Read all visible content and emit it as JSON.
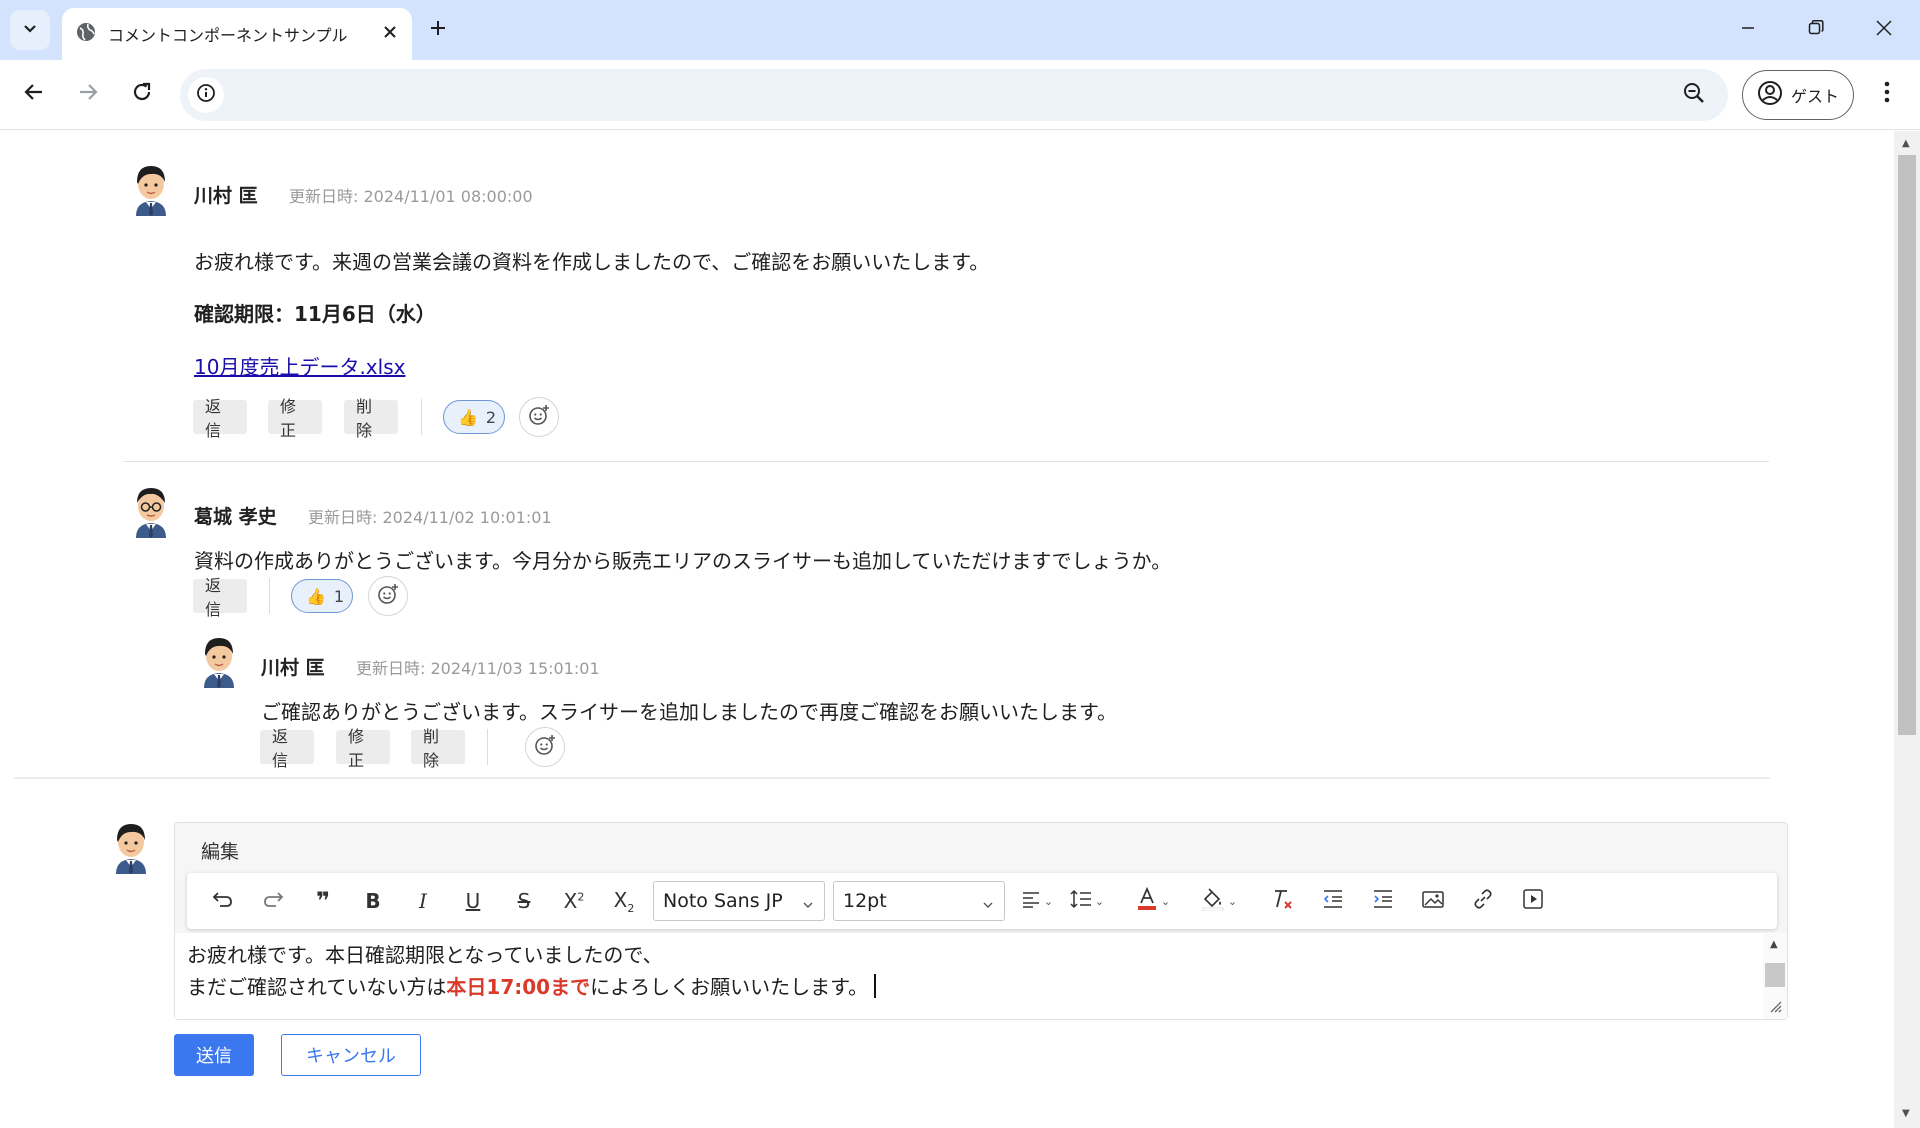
{
  "browser": {
    "tab_title": "コメントコンポーネントサンプル",
    "profile_label": "ゲスト"
  },
  "icons": {
    "tab_menu": "chevron-down-icon",
    "favicon": "globe-icon",
    "close_tab": "close-icon",
    "new_tab": "plus-icon",
    "back": "arrow-left-icon",
    "forward": "arrow-right-icon",
    "reload": "reload-icon",
    "site_info": "info-icon",
    "zoom": "zoom-out-icon",
    "profile": "account-circle-icon",
    "menu": "kebab-menu-icon"
  },
  "colors": {
    "accent": "#3b78f0",
    "highlight_text": "#d93a2a",
    "link": "#1a0dab",
    "reaction_border": "#6e97d6",
    "tabbar_bg": "#d3e3fd"
  },
  "comments": [
    {
      "author": "川村 匡",
      "timestamp": "更新日時: 2024/11/01 08:00:00",
      "body": "お疲れ様です。来週の営業会議の資料を作成しましたので、ご確認をお願いいたします。",
      "deadline": "確認期限：11月6日（水）",
      "attachment": "10月度売上データ.xlsx",
      "actions": {
        "reply": "返信",
        "edit": "修正",
        "delete": "削除"
      },
      "reaction": {
        "emoji": "👍",
        "count": "2"
      }
    },
    {
      "author": "葛城 孝史",
      "timestamp": "更新日時: 2024/11/02 10:01:01",
      "body": "資料の作成ありがとうございます。今月分から販売エリアのスライサーも追加していただけますでしょうか。",
      "actions": {
        "reply": "返信"
      },
      "reaction": {
        "emoji": "👍",
        "count": "1"
      }
    },
    {
      "author": "川村 匡",
      "timestamp": "更新日時: 2024/11/03 15:01:01",
      "body": "ご確認ありがとうございます。スライサーを追加しましたので再度ご確認をお願いいたします。",
      "actions": {
        "reply": "返信",
        "edit": "修正",
        "delete": "削除"
      }
    }
  ],
  "editor": {
    "label": "編集",
    "font_family": "Noto Sans JP",
    "font_size": "12pt",
    "line1": "お疲れ様です。本日確認期限となっていましたので、",
    "line2_prefix": "まだご確認されていない方は",
    "line2_highlight": "本日17:00まで",
    "line2_suffix": "によろしくお願いいたします。"
  },
  "buttons": {
    "send": "送信",
    "cancel": "キャンセル"
  }
}
